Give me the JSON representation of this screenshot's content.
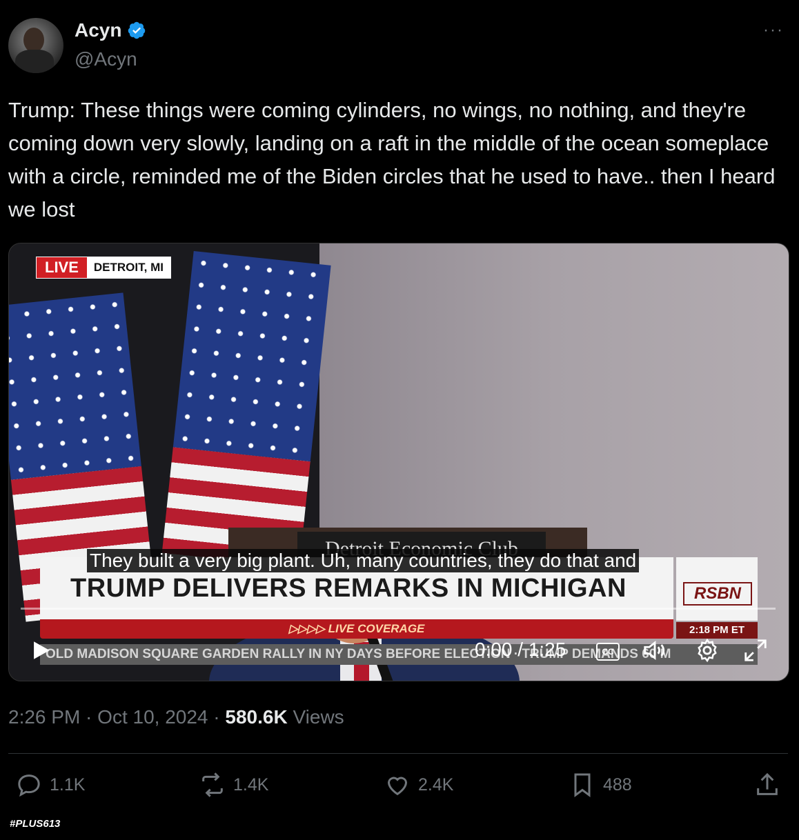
{
  "author": {
    "name": "Acyn",
    "handle": "@Acyn",
    "verified": true
  },
  "more_label": "···",
  "tweet_text": "Trump: These things were coming cylinders, no wings, no nothing, and they're coming down very slowly, landing on a raft in the middle of the ocean someplace with a circle, reminded me of the Biden circles that he used to have.. then I heard we lost",
  "video": {
    "live_label": "LIVE",
    "location": "DETROIT, MI",
    "podium_sign": "Detroit Economic Club",
    "headline": "TRUMP DELIVERS REMARKS IN MICHIGAN",
    "live_coverage": "▷▷▷▷ LIVE COVERAGE",
    "network": "RSBN",
    "network_time": "2:18 PM ET",
    "ticker": "OLD MADISON SQUARE GARDEN RALLY IN NY DAYS BEFORE ELECTION · TRUMP DEMANDS 60 M",
    "caption": "They built a very big plant. Uh, many countries, they do that and",
    "time_display": "0:00 / 1:25",
    "cc_label": "CC",
    "progress": 0
  },
  "meta": {
    "time": "2:26 PM",
    "sep": " · ",
    "date": "Oct 10, 2024",
    "views_count": "580.6K",
    "views_label": "Views"
  },
  "actions": {
    "replies": "1.1K",
    "reposts": "1.4K",
    "likes": "2.4K",
    "bookmarks": "488"
  },
  "watermark": "#PLUS613",
  "colors": {
    "accent": "#1d9bf0",
    "muted": "#71767b",
    "text": "#e7e9ea",
    "live_red": "#d11f24"
  }
}
